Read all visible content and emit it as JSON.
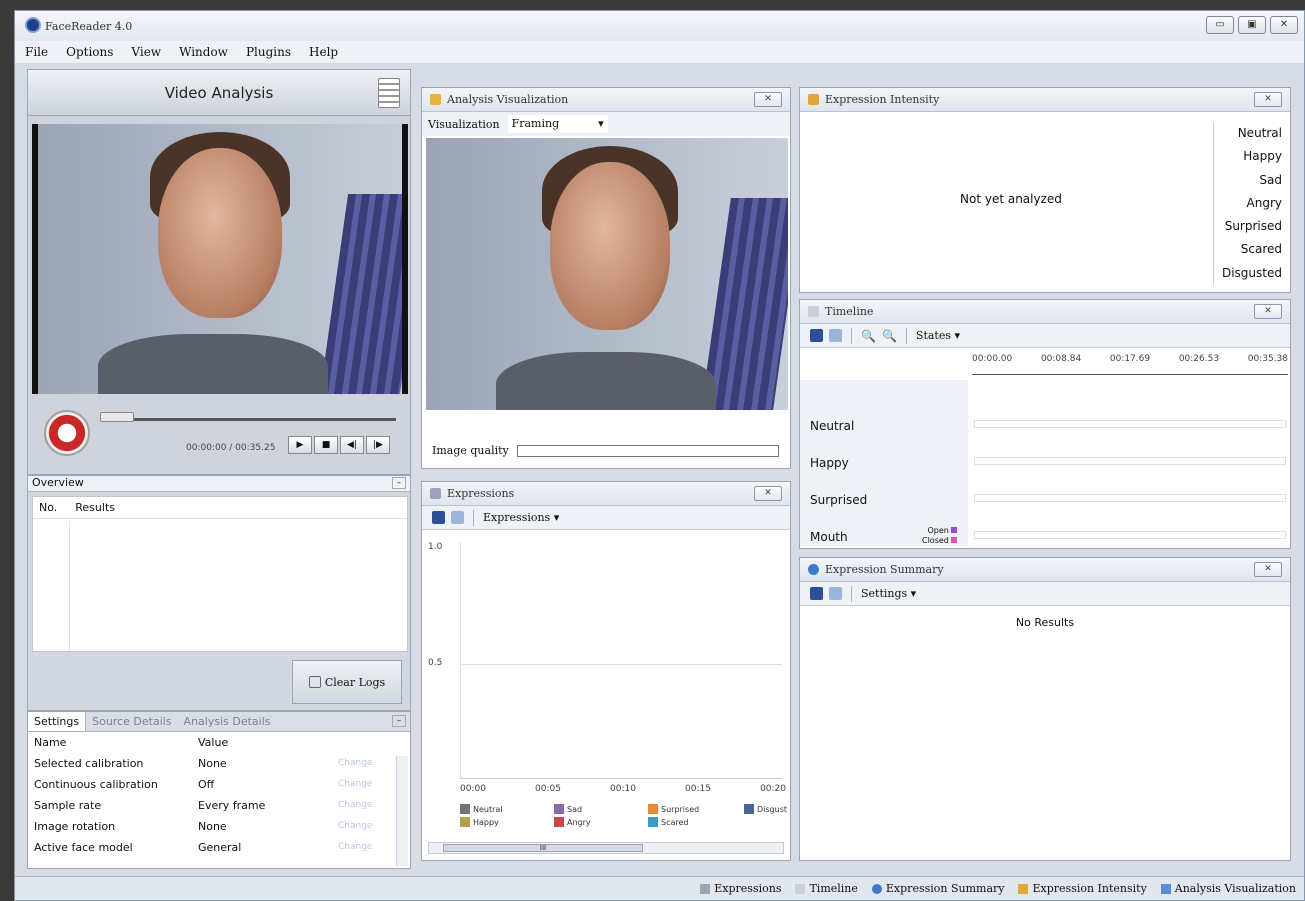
{
  "window": {
    "title": "FaceReader 4.0"
  },
  "menu": [
    "File",
    "Options",
    "View",
    "Window",
    "Plugins",
    "Help"
  ],
  "video_analysis": {
    "title": "Video Analysis",
    "time": "00:00:00 / 00:35.25"
  },
  "overview": {
    "title": "Overview",
    "col_no": "No.",
    "col_results": "Results",
    "clear_logs": "Clear Logs"
  },
  "settings": {
    "tabs": [
      "Settings",
      "Source Details",
      "Analysis Details"
    ],
    "col_name": "Name",
    "col_value": "Value",
    "rows": [
      {
        "name": "Selected calibration",
        "value": "None",
        "action": "Change"
      },
      {
        "name": "Continuous calibration",
        "value": "Off",
        "action": "Change"
      },
      {
        "name": "Sample rate",
        "value": "Every frame",
        "action": "Change"
      },
      {
        "name": "Image rotation",
        "value": "None",
        "action": "Change"
      },
      {
        "name": "Active face model",
        "value": "General",
        "action": "Change"
      }
    ]
  },
  "analysis_visualization": {
    "title": "Analysis Visualization",
    "vis_label": "Visualization",
    "vis_value": "Framing",
    "image_quality": "Image quality"
  },
  "expressions": {
    "title": "Expressions",
    "menu": "Expressions",
    "y_ticks": [
      "1.0",
      "0.5"
    ],
    "x_ticks": [
      "00:00",
      "00:05",
      "00:10",
      "00:15",
      "00:20"
    ],
    "legend": [
      {
        "name": "Neutral",
        "color": "#7a6e78"
      },
      {
        "name": "Sad",
        "color": "#8c6aa6"
      },
      {
        "name": "Surprised",
        "color": "#e08a3a"
      },
      {
        "name": "Disgust",
        "color": "#4c6294"
      },
      {
        "name": "Happy",
        "color": "#b0a24a"
      },
      {
        "name": "Angry",
        "color": "#c8464e"
      },
      {
        "name": "Scared",
        "color": "#3c9cc8"
      }
    ],
    "scroll": "III"
  },
  "expression_intensity": {
    "title": "Expression Intensity",
    "status": "Not yet analyzed",
    "labels": [
      "Neutral",
      "Happy",
      "Sad",
      "Angry",
      "Surprised",
      "Scared",
      "Disgusted"
    ]
  },
  "timeline": {
    "title": "Timeline",
    "menu": "States",
    "ticks": [
      "00:00.00",
      "00:08.84",
      "00:17.69",
      "00:26.53",
      "00:35.38"
    ],
    "rows": [
      "Neutral",
      "Happy",
      "Surprised",
      "Mouth"
    ],
    "mouth_open": "Open",
    "mouth_closed": "Closed"
  },
  "expression_summary": {
    "title": "Expression Summary",
    "menu": "Settings",
    "status": "No Results"
  },
  "statusbar": [
    "Expressions",
    "Timeline",
    "Expression Summary",
    "Expression Intensity",
    "Analysis Visualization"
  ]
}
